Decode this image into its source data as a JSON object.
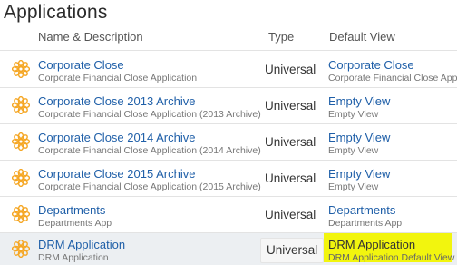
{
  "page": {
    "title": "Applications"
  },
  "columns": {
    "name": "Name & Description",
    "type": "Type",
    "view": "Default View"
  },
  "rows": [
    {
      "name": "Corporate Close",
      "desc": "Corporate Financial Close Application",
      "type": "Universal",
      "view": "Corporate Close",
      "view_desc": "Corporate Financial Close Applic"
    },
    {
      "name": "Corporate Close 2013 Archive",
      "desc": "Corporate Financial Close Application (2013 Archive)",
      "type": "Universal",
      "view": "Empty View",
      "view_desc": "Empty View"
    },
    {
      "name": "Corporate Close 2014 Archive",
      "desc": "Corporate Financial Close Application (2014 Archive)",
      "type": "Universal",
      "view": "Empty View",
      "view_desc": "Empty View"
    },
    {
      "name": "Corporate Close 2015 Archive",
      "desc": "Corporate Financial Close Application (2015 Archive)",
      "type": "Universal",
      "view": "Empty View",
      "view_desc": "Empty View"
    },
    {
      "name": "Departments",
      "desc": "Departments App",
      "type": "Universal",
      "view": "Departments",
      "view_desc": "Departments App"
    },
    {
      "name": "DRM Application",
      "desc": "DRM Application",
      "type": "Universal",
      "view": "DRM Application",
      "view_desc": "DRM Application Default View"
    }
  ],
  "colors": {
    "icon": "#f5a623",
    "link": "#1f5fa8",
    "highlight": "#f2f50e",
    "selected_row": "#eceff2"
  },
  "icons": {
    "row_icon": "app-flower-icon"
  }
}
